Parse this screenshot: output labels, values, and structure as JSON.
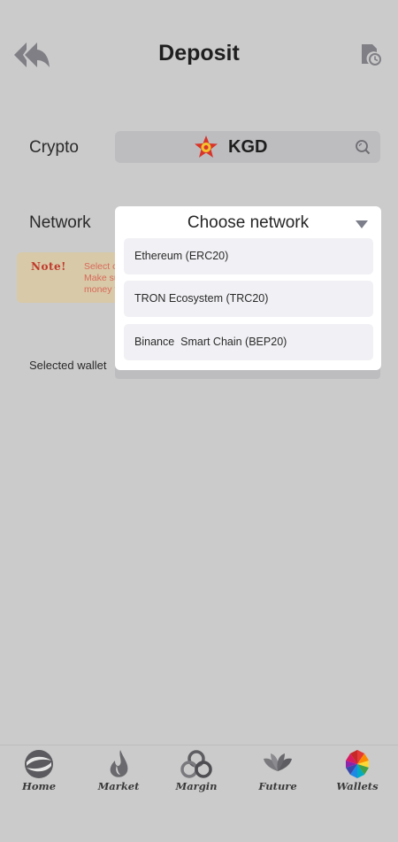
{
  "header": {
    "title": "Deposit"
  },
  "form": {
    "crypto_label": "Crypto",
    "crypto_value": "KGD",
    "network_label": "Network",
    "selected_wallet_label": "Selected wallet"
  },
  "note": {
    "title": "Note!",
    "lines": [
      "Select c",
      "Make su",
      "money t"
    ]
  },
  "dropdown": {
    "title": "Choose network",
    "options": [
      "Ethereum (ERC20)",
      "TRON Ecosystem (TRC20)",
      "Binance  Smart Chain (BEP20)"
    ]
  },
  "nav": {
    "items": [
      {
        "label": "Home",
        "icon": "home-icon"
      },
      {
        "label": "Market",
        "icon": "market-icon"
      },
      {
        "label": "Margin",
        "icon": "margin-icon"
      },
      {
        "label": "Future",
        "icon": "future-icon"
      },
      {
        "label": "Wallets",
        "icon": "wallets-icon"
      }
    ]
  },
  "colors": {
    "background": "#cbcbcb",
    "note_text": "#d86a5a",
    "note_title": "#c0392b"
  }
}
